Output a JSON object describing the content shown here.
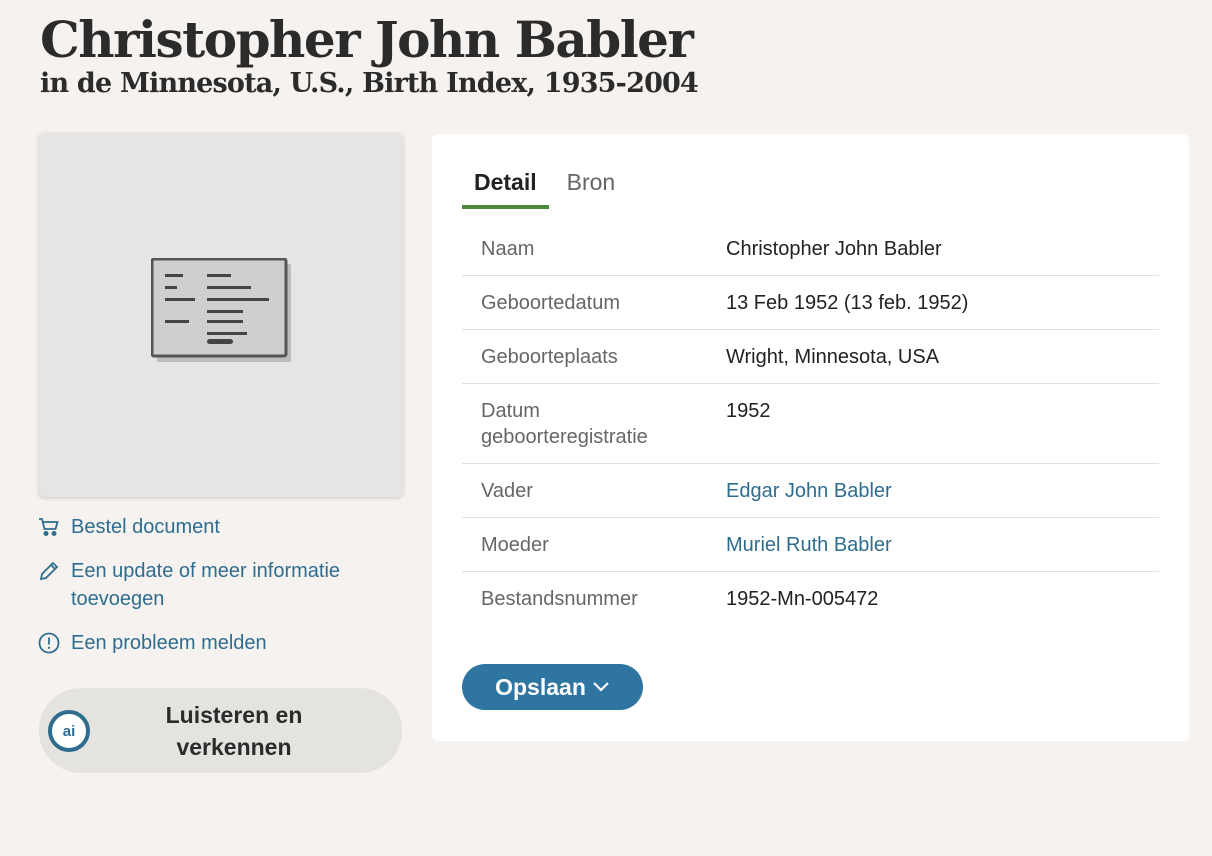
{
  "header": {
    "title": "Christopher John Babler",
    "subtitle": "in de Minnesota, U.S., Birth Index, 1935-2004"
  },
  "sidebar": {
    "order_document": "Bestel document",
    "update_info": "Een update of meer informatie toevoegen",
    "report_problem": "Een probleem melden",
    "listen_button": "Luisteren en verkennen",
    "ai_badge": "ai"
  },
  "tabs": [
    {
      "label": "Detail",
      "active": true
    },
    {
      "label": "Bron",
      "active": false
    }
  ],
  "details": [
    {
      "label": "Naam",
      "value": "Christopher John Babler",
      "link": false
    },
    {
      "label": "Geboortedatum",
      "value": "13 Feb 1952 (13 feb. 1952)",
      "link": false
    },
    {
      "label": "Geboorteplaats",
      "value": "Wright, Minnesota, USA",
      "link": false
    },
    {
      "label": "Datum geboorteregistratie",
      "value": "1952",
      "link": false
    },
    {
      "label": "Vader",
      "value": "Edgar John Babler",
      "link": true
    },
    {
      "label": "Moeder",
      "value": "Muriel Ruth Babler",
      "link": true
    },
    {
      "label": "Bestandsnummer",
      "value": "1952-Mn-005472",
      "link": false
    }
  ],
  "actions": {
    "save_label": "Opslaan"
  },
  "colors": {
    "background": "#f5f2ef",
    "link": "#2f6d8e",
    "primary_button": "#2f75a2",
    "active_tab_underline": "#4a8a3a"
  },
  "icons": [
    "document-placeholder-icon",
    "cart-icon",
    "pencil-icon",
    "alert-circle-icon",
    "ai-icon",
    "chevron-down-icon"
  ]
}
